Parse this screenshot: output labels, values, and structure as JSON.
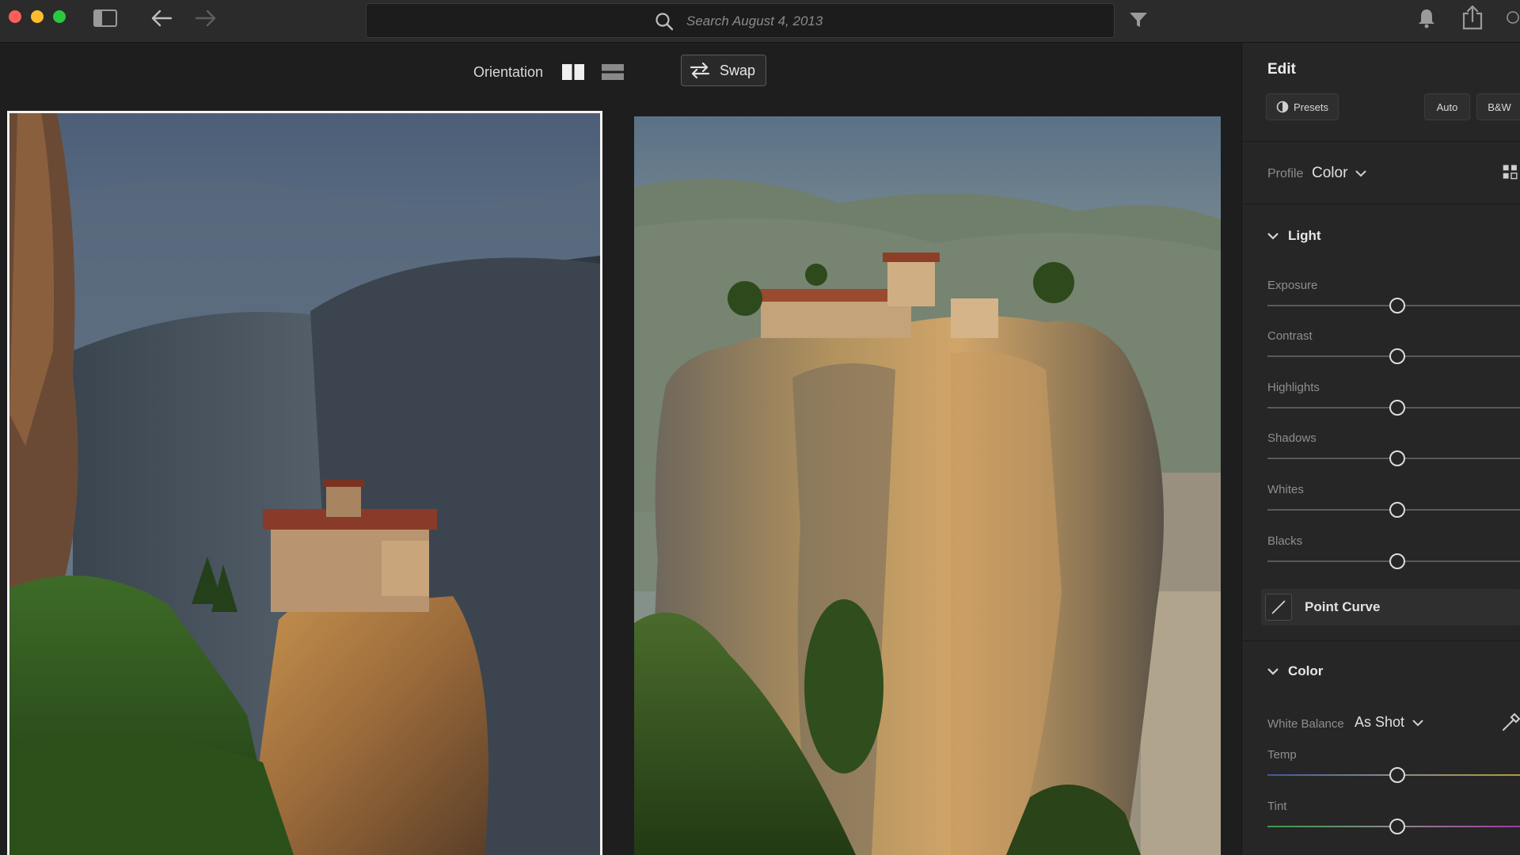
{
  "window": {
    "search": {
      "placeholder": "Search August 4, 2013",
      "value": ""
    },
    "icons": [
      "sidebar-toggle-icon",
      "back-arrow-icon",
      "forward-arrow-icon",
      "search-icon",
      "filter-icon",
      "bell-icon",
      "share-icon",
      "help-icon"
    ]
  },
  "compare": {
    "orientation_label": "Orientation",
    "swap_label": "Swap",
    "selected_photo": "left"
  },
  "edit_panel": {
    "title": "Edit",
    "presets_label": "Presets",
    "auto_label": "Auto",
    "bw_label": "B&W",
    "profile": {
      "label": "Profile",
      "value": "Color"
    },
    "light": {
      "title": "Light",
      "sliders": [
        {
          "label": "Exposure",
          "value": 0
        },
        {
          "label": "Contrast",
          "value": 0
        },
        {
          "label": "Highlights",
          "value": 0
        },
        {
          "label": "Shadows",
          "value": 0
        },
        {
          "label": "Whites",
          "value": 0
        },
        {
          "label": "Blacks",
          "value": 0
        }
      ],
      "point_curve_label": "Point Curve"
    },
    "color": {
      "title": "Color",
      "white_balance": {
        "label": "White Balance",
        "value": "As Shot"
      },
      "sliders": [
        {
          "label": "Temp",
          "value": 0
        },
        {
          "label": "Tint",
          "value": 0
        }
      ]
    }
  },
  "colors": {
    "panel_bg": "#262626",
    "app_bg": "#1e1e1e",
    "topbar_bg": "#2b2b2b",
    "selected_border": "#f2f2f2"
  }
}
